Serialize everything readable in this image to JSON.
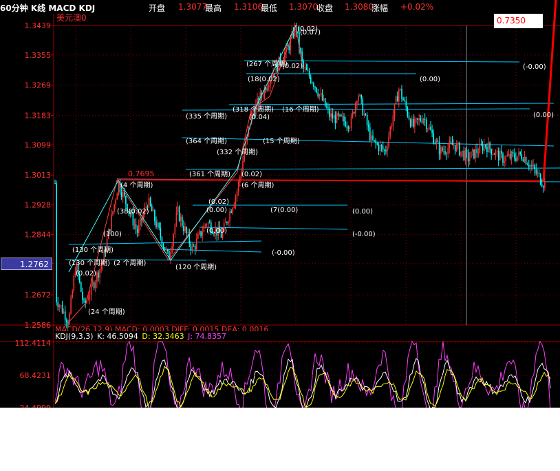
{
  "header": {
    "title": "60分钟 K线 MACD KDJ",
    "open_label": "开盘",
    "open_value": "1.3077",
    "high_label": "最高",
    "high_value": "1.3106",
    "low_label": "最低",
    "low_value": "1.3070",
    "close_label": "收盘",
    "close_value": "1.3080",
    "change_label": "涨幅",
    "change_value": "+0.02%"
  },
  "symbol": "美元澳0",
  "price_box": "0.7350",
  "current_price": "1.2762",
  "macd_text": "MACD(26,12,9) MACD: 0.0003 DIFF: 0.0015 DEA: 0.0016",
  "kdj_text": {
    "name": "KDJ(9,3,3)",
    "k": "K: 46.5094",
    "d": "D: 32.3463",
    "j": "J: 74.8357"
  },
  "colors": {
    "background": "#000000",
    "up": "#ff3030",
    "down": "#00ffff",
    "grid": "#800000",
    "trend": "#00c8ff",
    "k": "#ffffff",
    "d": "#ffff00",
    "j": "#ff40ff"
  },
  "chart_data": [
    {
      "type": "candlestick",
      "y_ticks": [
        "1.3439",
        "1.3355",
        "1.3269",
        "1.3183",
        "1.3099",
        "1.3013",
        "1.2928",
        "1.2844",
        "1.2762",
        "1.2672",
        "1.2586"
      ],
      "ylim": [
        1.2586,
        1.3439
      ],
      "level_label": "0.7695",
      "ohlc_summary": {
        "open": 1.3077,
        "high": 1.3106,
        "low": 1.307,
        "close": 1.308
      },
      "annotations": [
        "(0.02)",
        "(0.07)",
        "(267 个周期)",
        "(-0.00)",
        "(0.02)",
        "(18(0.02)",
        "(0.00)",
        "(318 个周期)",
        "(16 个周期)",
        "(335 个周期)",
        "(0.00)",
        "(0.04)",
        "(364 个周期)",
        "(15 个周期)",
        "(332 个周期)",
        "(361 个周期)",
        "(0.02)",
        "(6 个周期)",
        "(4 个周期)",
        "(0.02)",
        "(0.00)",
        "(7(0.00)",
        "(0.00)",
        "(38(0.02)",
        "(100)",
        "(0.00)",
        "(-0.00)",
        "(130 个周期)",
        "(-0.00)",
        "(130 个周期)",
        "(2 个周期)",
        "(120 个周期)",
        "(0.02)",
        "(24 个周期)"
      ]
    },
    {
      "type": "line",
      "name": "KDJ",
      "y_ticks": [
        "112.4114",
        "68.4231",
        "24.4999"
      ],
      "ylim": [
        24.4999,
        112.4114
      ]
    }
  ]
}
